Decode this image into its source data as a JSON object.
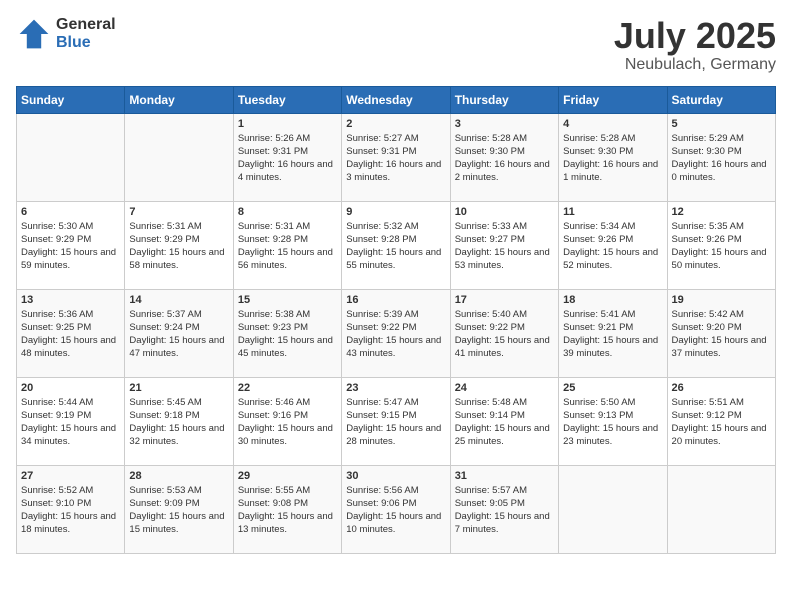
{
  "logo": {
    "line1": "General",
    "line2": "Blue"
  },
  "title": "July 2025",
  "location": "Neubulach, Germany",
  "days_of_week": [
    "Sunday",
    "Monday",
    "Tuesday",
    "Wednesday",
    "Thursday",
    "Friday",
    "Saturday"
  ],
  "weeks": [
    [
      {
        "day": "",
        "info": ""
      },
      {
        "day": "",
        "info": ""
      },
      {
        "day": "1",
        "info": "Sunrise: 5:26 AM\nSunset: 9:31 PM\nDaylight: 16 hours and 4 minutes."
      },
      {
        "day": "2",
        "info": "Sunrise: 5:27 AM\nSunset: 9:31 PM\nDaylight: 16 hours and 3 minutes."
      },
      {
        "day": "3",
        "info": "Sunrise: 5:28 AM\nSunset: 9:30 PM\nDaylight: 16 hours and 2 minutes."
      },
      {
        "day": "4",
        "info": "Sunrise: 5:28 AM\nSunset: 9:30 PM\nDaylight: 16 hours and 1 minute."
      },
      {
        "day": "5",
        "info": "Sunrise: 5:29 AM\nSunset: 9:30 PM\nDaylight: 16 hours and 0 minutes."
      }
    ],
    [
      {
        "day": "6",
        "info": "Sunrise: 5:30 AM\nSunset: 9:29 PM\nDaylight: 15 hours and 59 minutes."
      },
      {
        "day": "7",
        "info": "Sunrise: 5:31 AM\nSunset: 9:29 PM\nDaylight: 15 hours and 58 minutes."
      },
      {
        "day": "8",
        "info": "Sunrise: 5:31 AM\nSunset: 9:28 PM\nDaylight: 15 hours and 56 minutes."
      },
      {
        "day": "9",
        "info": "Sunrise: 5:32 AM\nSunset: 9:28 PM\nDaylight: 15 hours and 55 minutes."
      },
      {
        "day": "10",
        "info": "Sunrise: 5:33 AM\nSunset: 9:27 PM\nDaylight: 15 hours and 53 minutes."
      },
      {
        "day": "11",
        "info": "Sunrise: 5:34 AM\nSunset: 9:26 PM\nDaylight: 15 hours and 52 minutes."
      },
      {
        "day": "12",
        "info": "Sunrise: 5:35 AM\nSunset: 9:26 PM\nDaylight: 15 hours and 50 minutes."
      }
    ],
    [
      {
        "day": "13",
        "info": "Sunrise: 5:36 AM\nSunset: 9:25 PM\nDaylight: 15 hours and 48 minutes."
      },
      {
        "day": "14",
        "info": "Sunrise: 5:37 AM\nSunset: 9:24 PM\nDaylight: 15 hours and 47 minutes."
      },
      {
        "day": "15",
        "info": "Sunrise: 5:38 AM\nSunset: 9:23 PM\nDaylight: 15 hours and 45 minutes."
      },
      {
        "day": "16",
        "info": "Sunrise: 5:39 AM\nSunset: 9:22 PM\nDaylight: 15 hours and 43 minutes."
      },
      {
        "day": "17",
        "info": "Sunrise: 5:40 AM\nSunset: 9:22 PM\nDaylight: 15 hours and 41 minutes."
      },
      {
        "day": "18",
        "info": "Sunrise: 5:41 AM\nSunset: 9:21 PM\nDaylight: 15 hours and 39 minutes."
      },
      {
        "day": "19",
        "info": "Sunrise: 5:42 AM\nSunset: 9:20 PM\nDaylight: 15 hours and 37 minutes."
      }
    ],
    [
      {
        "day": "20",
        "info": "Sunrise: 5:44 AM\nSunset: 9:19 PM\nDaylight: 15 hours and 34 minutes."
      },
      {
        "day": "21",
        "info": "Sunrise: 5:45 AM\nSunset: 9:18 PM\nDaylight: 15 hours and 32 minutes."
      },
      {
        "day": "22",
        "info": "Sunrise: 5:46 AM\nSunset: 9:16 PM\nDaylight: 15 hours and 30 minutes."
      },
      {
        "day": "23",
        "info": "Sunrise: 5:47 AM\nSunset: 9:15 PM\nDaylight: 15 hours and 28 minutes."
      },
      {
        "day": "24",
        "info": "Sunrise: 5:48 AM\nSunset: 9:14 PM\nDaylight: 15 hours and 25 minutes."
      },
      {
        "day": "25",
        "info": "Sunrise: 5:50 AM\nSunset: 9:13 PM\nDaylight: 15 hours and 23 minutes."
      },
      {
        "day": "26",
        "info": "Sunrise: 5:51 AM\nSunset: 9:12 PM\nDaylight: 15 hours and 20 minutes."
      }
    ],
    [
      {
        "day": "27",
        "info": "Sunrise: 5:52 AM\nSunset: 9:10 PM\nDaylight: 15 hours and 18 minutes."
      },
      {
        "day": "28",
        "info": "Sunrise: 5:53 AM\nSunset: 9:09 PM\nDaylight: 15 hours and 15 minutes."
      },
      {
        "day": "29",
        "info": "Sunrise: 5:55 AM\nSunset: 9:08 PM\nDaylight: 15 hours and 13 minutes."
      },
      {
        "day": "30",
        "info": "Sunrise: 5:56 AM\nSunset: 9:06 PM\nDaylight: 15 hours and 10 minutes."
      },
      {
        "day": "31",
        "info": "Sunrise: 5:57 AM\nSunset: 9:05 PM\nDaylight: 15 hours and 7 minutes."
      },
      {
        "day": "",
        "info": ""
      },
      {
        "day": "",
        "info": ""
      }
    ]
  ]
}
